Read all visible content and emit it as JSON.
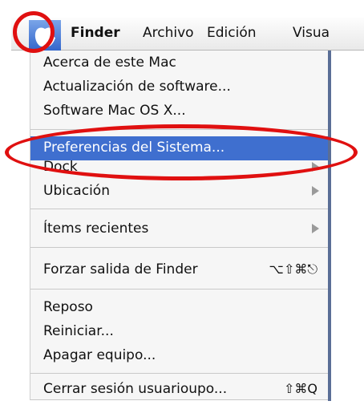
{
  "menubar": {
    "apple_icon": "apple-icon",
    "items": [
      "Finder",
      "Archivo",
      "Edición",
      "Visua"
    ]
  },
  "menu": {
    "items": [
      {
        "label": "Acerca de este Mac"
      },
      {
        "label": "Actualización de software..."
      },
      {
        "label": "Software Mac OS X..."
      },
      {
        "label": "Preferencias del Sistema...",
        "selected": true
      },
      {
        "label": "Dock",
        "submenu": true
      },
      {
        "label": "Ubicación",
        "submenu": true
      },
      {
        "label": "Ítems recientes",
        "submenu": true
      },
      {
        "label": "Forzar salida de Finder",
        "shortcut": "⌥⇧⌘⎋"
      },
      {
        "label": "Reposo"
      },
      {
        "label": "Reiniciar..."
      },
      {
        "label": "Apagar equipo..."
      },
      {
        "label": "Cerrar sesión usuarioupo...",
        "shortcut": "⇧⌘Q"
      }
    ]
  },
  "colors": {
    "selection": "#3f6fcf",
    "annotation": "#e01010"
  }
}
